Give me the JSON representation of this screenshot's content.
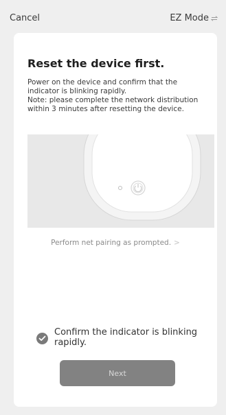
{
  "header": {
    "cancel_label": "Cancel",
    "mode_label": "EZ Mode",
    "mode_icon": "swap-icon"
  },
  "card": {
    "title": "Reset the device first.",
    "description_lines": [
      "Power on the device and confirm that the indicator is blinking rapidly.",
      "Note: please complete the network distribution within 3 minutes after resetting the device."
    ],
    "illustration_icon": "device-power-button-illustration",
    "prompt_link": "Perform net pairing as prompted.",
    "prompt_chevron": ">",
    "confirm_checked": true,
    "confirm_label": "Confirm the indicator is blinking rapidly.",
    "next_label": "Next"
  },
  "colors": {
    "background": "#efefef",
    "card": "#ffffff",
    "illustration_bg": "#e8e8e8",
    "button_disabled": "#828282",
    "check": "#7a7a7a"
  }
}
